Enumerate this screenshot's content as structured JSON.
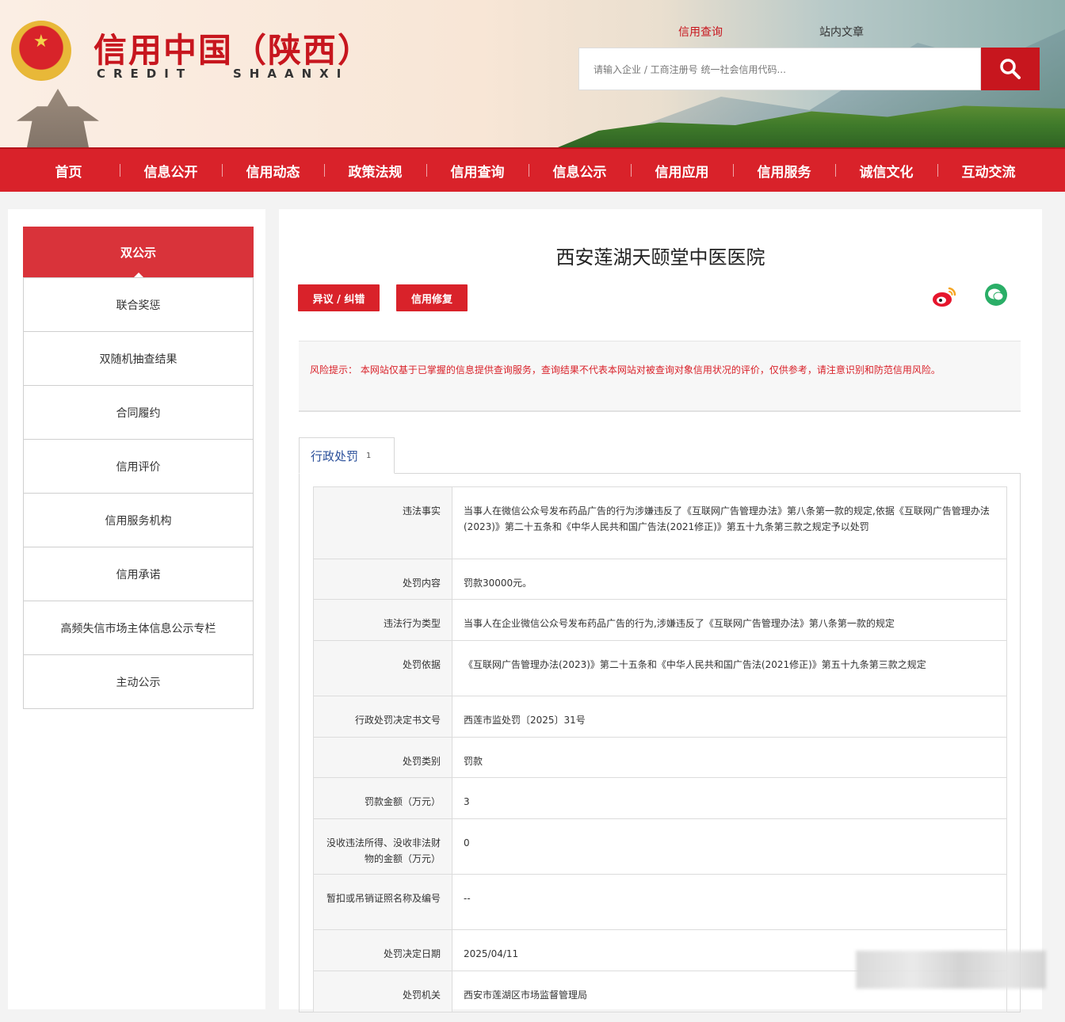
{
  "brand": {
    "title": "信用中国（陕西）",
    "sub_en_1": "CREDIT",
    "sub_en_2": "SHAANXI"
  },
  "search": {
    "tabs": [
      "信用查询",
      "站内文章"
    ],
    "placeholder": "请输入企业 / 工商注册号 统一社会信用代码..."
  },
  "nav": [
    "首页",
    "信息公开",
    "信用动态",
    "政策法规",
    "信用查询",
    "信息公示",
    "信用应用",
    "信用服务",
    "诚信文化",
    "互动交流"
  ],
  "sidebar": {
    "header": "双公示",
    "items": [
      "联合奖惩",
      "双随机抽查结果",
      "合同履约",
      "信用评价",
      "信用服务机构",
      "信用承诺",
      "高频失信市场主体信息公示专栏",
      "主动公示"
    ]
  },
  "main": {
    "title": "西安莲湖天颐堂中医医院",
    "buttons": {
      "objection": "异议 / 纠错",
      "repair": "信用修复"
    },
    "risk": {
      "label": "风险提示：",
      "text": "本网站仅基于已掌握的信息提供查询服务，查询结果不代表本网站对被查询对象信用状况的评价，仅供参考，请注意识别和防范信用风险。"
    },
    "tab": {
      "label": "行政处罚",
      "count": "1"
    },
    "rows": [
      {
        "key": "违法事实",
        "value": "当事人在微信公众号发布药品广告的行为涉嫌违反了《互联网广告管理办法》第八条第一款的规定,依据《互联网广告管理办法(2023)》第二十五条和《中华人民共和国广告法(2021修正)》第五十九条第三款之规定予以处罚"
      },
      {
        "key": "处罚内容",
        "value": "罚款30000元。"
      },
      {
        "key": "违法行为类型",
        "value": "当事人在企业微信公众号发布药品广告的行为,涉嫌违反了《互联网广告管理办法》第八条第一款的规定"
      },
      {
        "key": "处罚依据",
        "value": "《互联网广告管理办法(2023)》第二十五条和《中华人民共和国广告法(2021修正)》第五十九条第三款之规定"
      },
      {
        "key": "行政处罚决定书文号",
        "value": "西莲市监处罚〔2025〕31号"
      },
      {
        "key": "处罚类别",
        "value": "罚款"
      },
      {
        "key": "罚款金额（万元）",
        "value": "3"
      },
      {
        "key": "没收违法所得、没收非法财物的金额（万元）",
        "value": "0"
      },
      {
        "key": "暂扣或吊销证照名称及编号",
        "value": "--"
      },
      {
        "key": "处罚决定日期",
        "value": "2025/04/11"
      },
      {
        "key": "处罚机关",
        "value": "西安市莲湖区市场监督管理局"
      }
    ]
  },
  "colors": {
    "brand_red": "#d9222a",
    "title_red": "#c7161e",
    "tab_blue": "#2a4f9a"
  },
  "icons": [
    "search-icon",
    "weibo-icon",
    "wechat-icon",
    "national-emblem-icon"
  ]
}
